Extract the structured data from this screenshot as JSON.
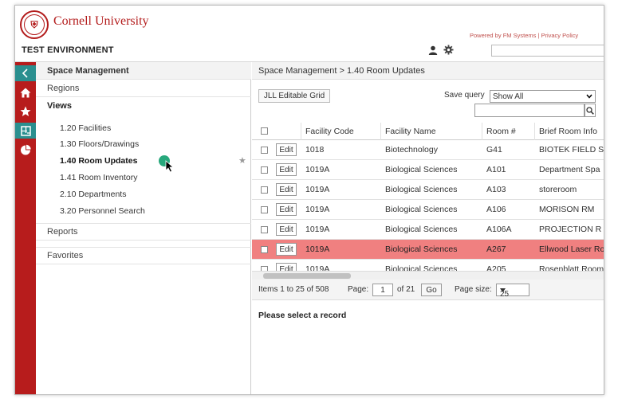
{
  "header": {
    "brand": "Cornell University",
    "environment": "TEST ENVIRONMENT",
    "powered_by": "Powered by FM Systems | Privacy Policy"
  },
  "sidebar": {
    "section_title": "Space Management",
    "regions": "Regions",
    "views": "Views",
    "items": [
      {
        "label": "1.20 Facilities"
      },
      {
        "label": "1.30 Floors/Drawings"
      },
      {
        "label": "1.40 Room Updates"
      },
      {
        "label": "1.41 Room Inventory"
      },
      {
        "label": "2.10 Departments"
      },
      {
        "label": "3.20 Personnel Search"
      }
    ],
    "reports": "Reports",
    "favorites": "Favorites"
  },
  "main": {
    "breadcrumb": "Space Management  > 1.40 Room Updates",
    "editable_grid_button": "JLL Editable Grid",
    "save_query_label": "Save query",
    "save_query_value": "Show All",
    "columns": [
      "Facility Code",
      "Facility Name",
      "Room #",
      "Brief Room Info"
    ],
    "edit_label": "Edit",
    "rows": [
      {
        "code": "1018",
        "name": "Biotechnology",
        "room": "G41",
        "info": "BIOTEK FIELD ST"
      },
      {
        "code": "1019A",
        "name": "Biological Sciences",
        "room": "A101",
        "info": "Department Spa"
      },
      {
        "code": "1019A",
        "name": "Biological Sciences",
        "room": "A103",
        "info": "storeroom"
      },
      {
        "code": "1019A",
        "name": "Biological Sciences",
        "room": "A106",
        "info": "MORISON RM"
      },
      {
        "code": "1019A",
        "name": "Biological Sciences",
        "room": "A106A",
        "info": "PROJECTION R"
      },
      {
        "code": "1019A",
        "name": "Biological Sciences",
        "room": "A267",
        "info": "Ellwood Laser Ro"
      },
      {
        "code": "1019A",
        "name": "Biological Sciences",
        "room": "A205",
        "info": "Rosenblatt Room"
      }
    ],
    "pager": {
      "items_text": "Items 1 to 25 of 508",
      "page_label": "Page:",
      "page_value": "1",
      "of_text": "of 21",
      "go_label": "Go",
      "page_size_label": "Page size:",
      "page_size_value": "25"
    },
    "detail_message": "Please select a record"
  },
  "colors": {
    "brand_red": "#b31b1b",
    "rail_red": "#b71c1c",
    "rail_teal": "#2a8f8f",
    "highlight_row": "#f08080",
    "toggle_green": "#27a87c"
  }
}
